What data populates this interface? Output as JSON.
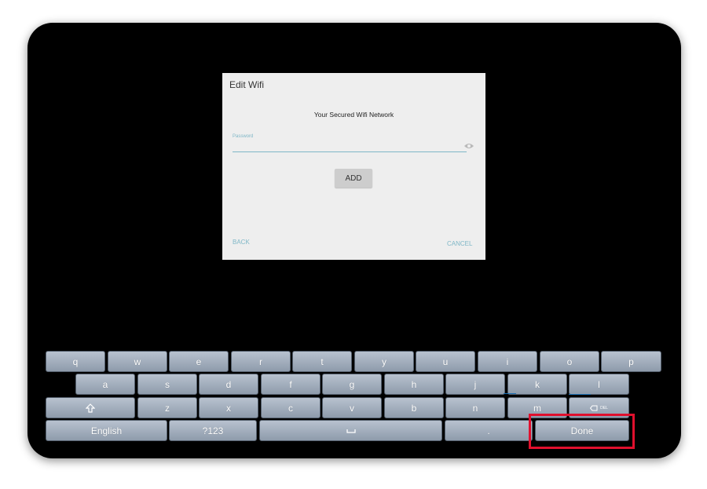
{
  "dialog": {
    "title": "Edit Wifi",
    "network_label": "Your Secured Wifi Network",
    "password_label": "Password",
    "password_value": "",
    "add_label": "ADD",
    "back_label": "BACK",
    "cancel_label": "CANCEL"
  },
  "keyboard": {
    "row1": [
      "q",
      "w",
      "e",
      "r",
      "t",
      "y",
      "u",
      "i",
      "o",
      "p"
    ],
    "row2": [
      "a",
      "s",
      "d",
      "f",
      "g",
      "h",
      "j",
      "k",
      "l"
    ],
    "row3": [
      "z",
      "x",
      "c",
      "v",
      "b",
      "n",
      "m"
    ],
    "shift_icon": "shift-arrow-icon",
    "delete_label": "DEL",
    "language_label": "English",
    "symbols_label": "?123",
    "space_icon": "space-bar-icon",
    "period_label": ".",
    "done_label": "Done"
  },
  "colors": {
    "accent": "#7fb7c7",
    "highlight": "#e0102d",
    "key_top": "#b8c2cf",
    "key_bottom": "#8e9bab"
  }
}
